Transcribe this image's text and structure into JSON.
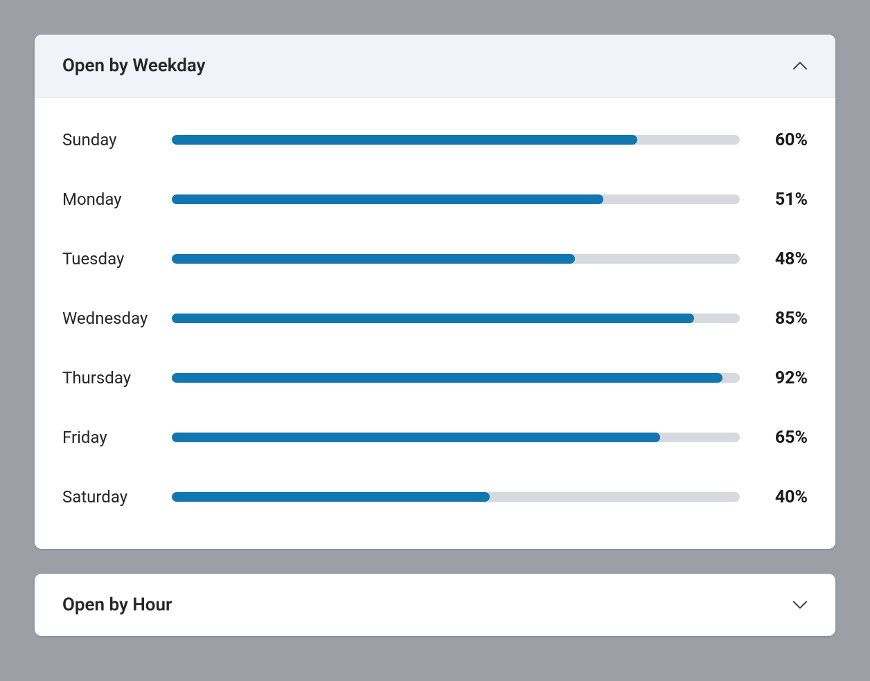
{
  "colors": {
    "bar_fill": "#1276b1",
    "bar_track": "#d6d9dd",
    "header_expanded_bg": "#f2f3f8",
    "page_bg": "#9ca0a6"
  },
  "panels": {
    "weekday": {
      "title": "Open by Weekday",
      "expanded": true
    },
    "hour": {
      "title": "Open by Hour",
      "expanded": false
    }
  },
  "chart_data": {
    "type": "bar",
    "title": "Open by Weekday",
    "xlabel": "",
    "ylabel": "",
    "ylim": [
      0,
      100
    ],
    "categories": [
      "Sunday",
      "Monday",
      "Tuesday",
      "Wednesday",
      "Thursday",
      "Friday",
      "Saturday"
    ],
    "values": [
      60,
      51,
      48,
      85,
      92,
      65,
      40
    ],
    "value_labels": [
      "60%",
      "51%",
      "48%",
      "85%",
      "92%",
      "65%",
      "40%"
    ],
    "rendered_fill_pct": [
      82,
      76,
      71,
      92,
      97,
      86,
      56
    ]
  }
}
